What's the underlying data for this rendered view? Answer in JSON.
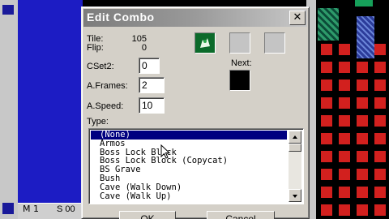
{
  "status": {
    "left": "M 1",
    "right": "S 00"
  },
  "dialog": {
    "title": "Edit Combo",
    "close_glyph": "✕",
    "tile_label": "Tile:",
    "tile_value": "105",
    "flip_label": "Flip:",
    "flip_value": "0",
    "cset2_label": "CSet2:",
    "cset2_value": "0",
    "aframes_label": "A.Frames:",
    "aframes_value": "2",
    "aspeed_label": "A.Speed:",
    "aspeed_value": "10",
    "next_label": "Next:",
    "type_label": "Type:",
    "type_options": [
      "(None)",
      "Armos",
      "Boss Lock Block",
      "Boss Lock Block (Copycat)",
      "BS Grave",
      "Bush",
      "Cave (Walk Down)",
      "Cave (Walk Up)"
    ],
    "selected_index": 0,
    "ok_label": "OK",
    "cancel_label": "Cancel"
  },
  "colors": {
    "selection": "#000080",
    "dialog_bg": "#d4d0c8",
    "map_blue": "#1c1cc4",
    "tile_red": "#d2201e"
  },
  "icons": {
    "combo_preview": "green-creature-icon",
    "close": "close-icon"
  }
}
